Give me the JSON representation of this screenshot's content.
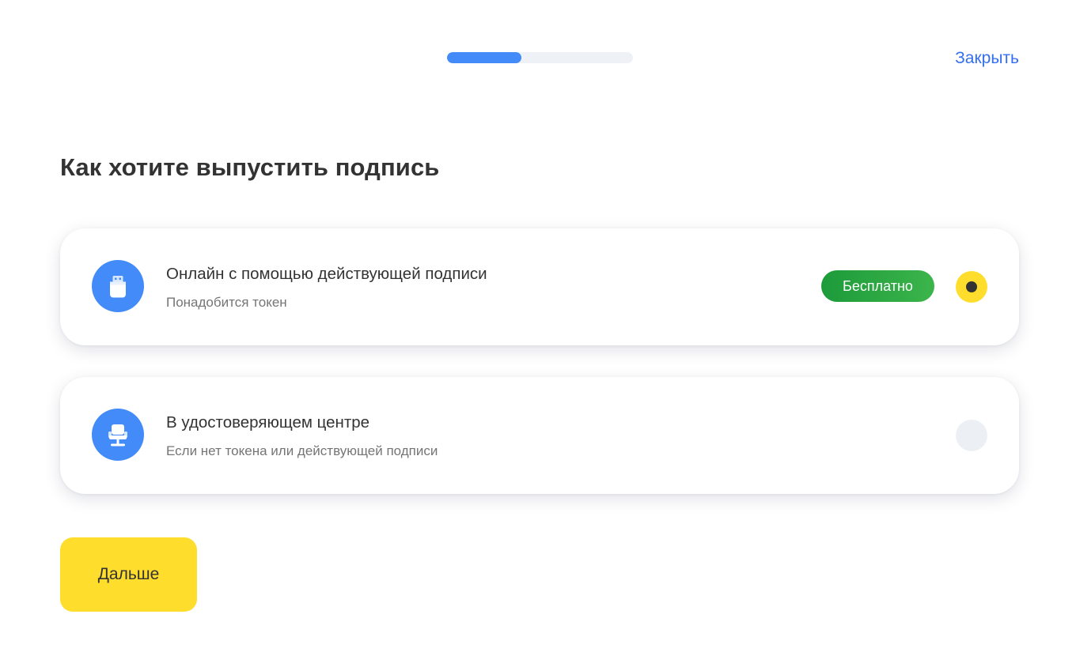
{
  "header": {
    "progress": 0.4,
    "close_label": "Закрыть"
  },
  "title": "Как хотите выпустить подпись",
  "options": [
    {
      "title": "Онлайн с помощью действующей подписи",
      "subtitle": "Понадобится токен",
      "badge": "Бесплатно",
      "icon": "usb-token-icon",
      "selected": true
    },
    {
      "title": "В удостоверяющем центре",
      "subtitle": "Если нет токена или действующей подписи",
      "icon": "office-chair-icon",
      "selected": false
    }
  ],
  "next_label": "Дальше",
  "colors": {
    "accent_blue": "#428bf9",
    "link_blue": "#336fee",
    "primary_yellow": "#ffdd2d",
    "badge_green": "#2aa842",
    "text_dark": "#333333",
    "text_muted": "#757575"
  }
}
